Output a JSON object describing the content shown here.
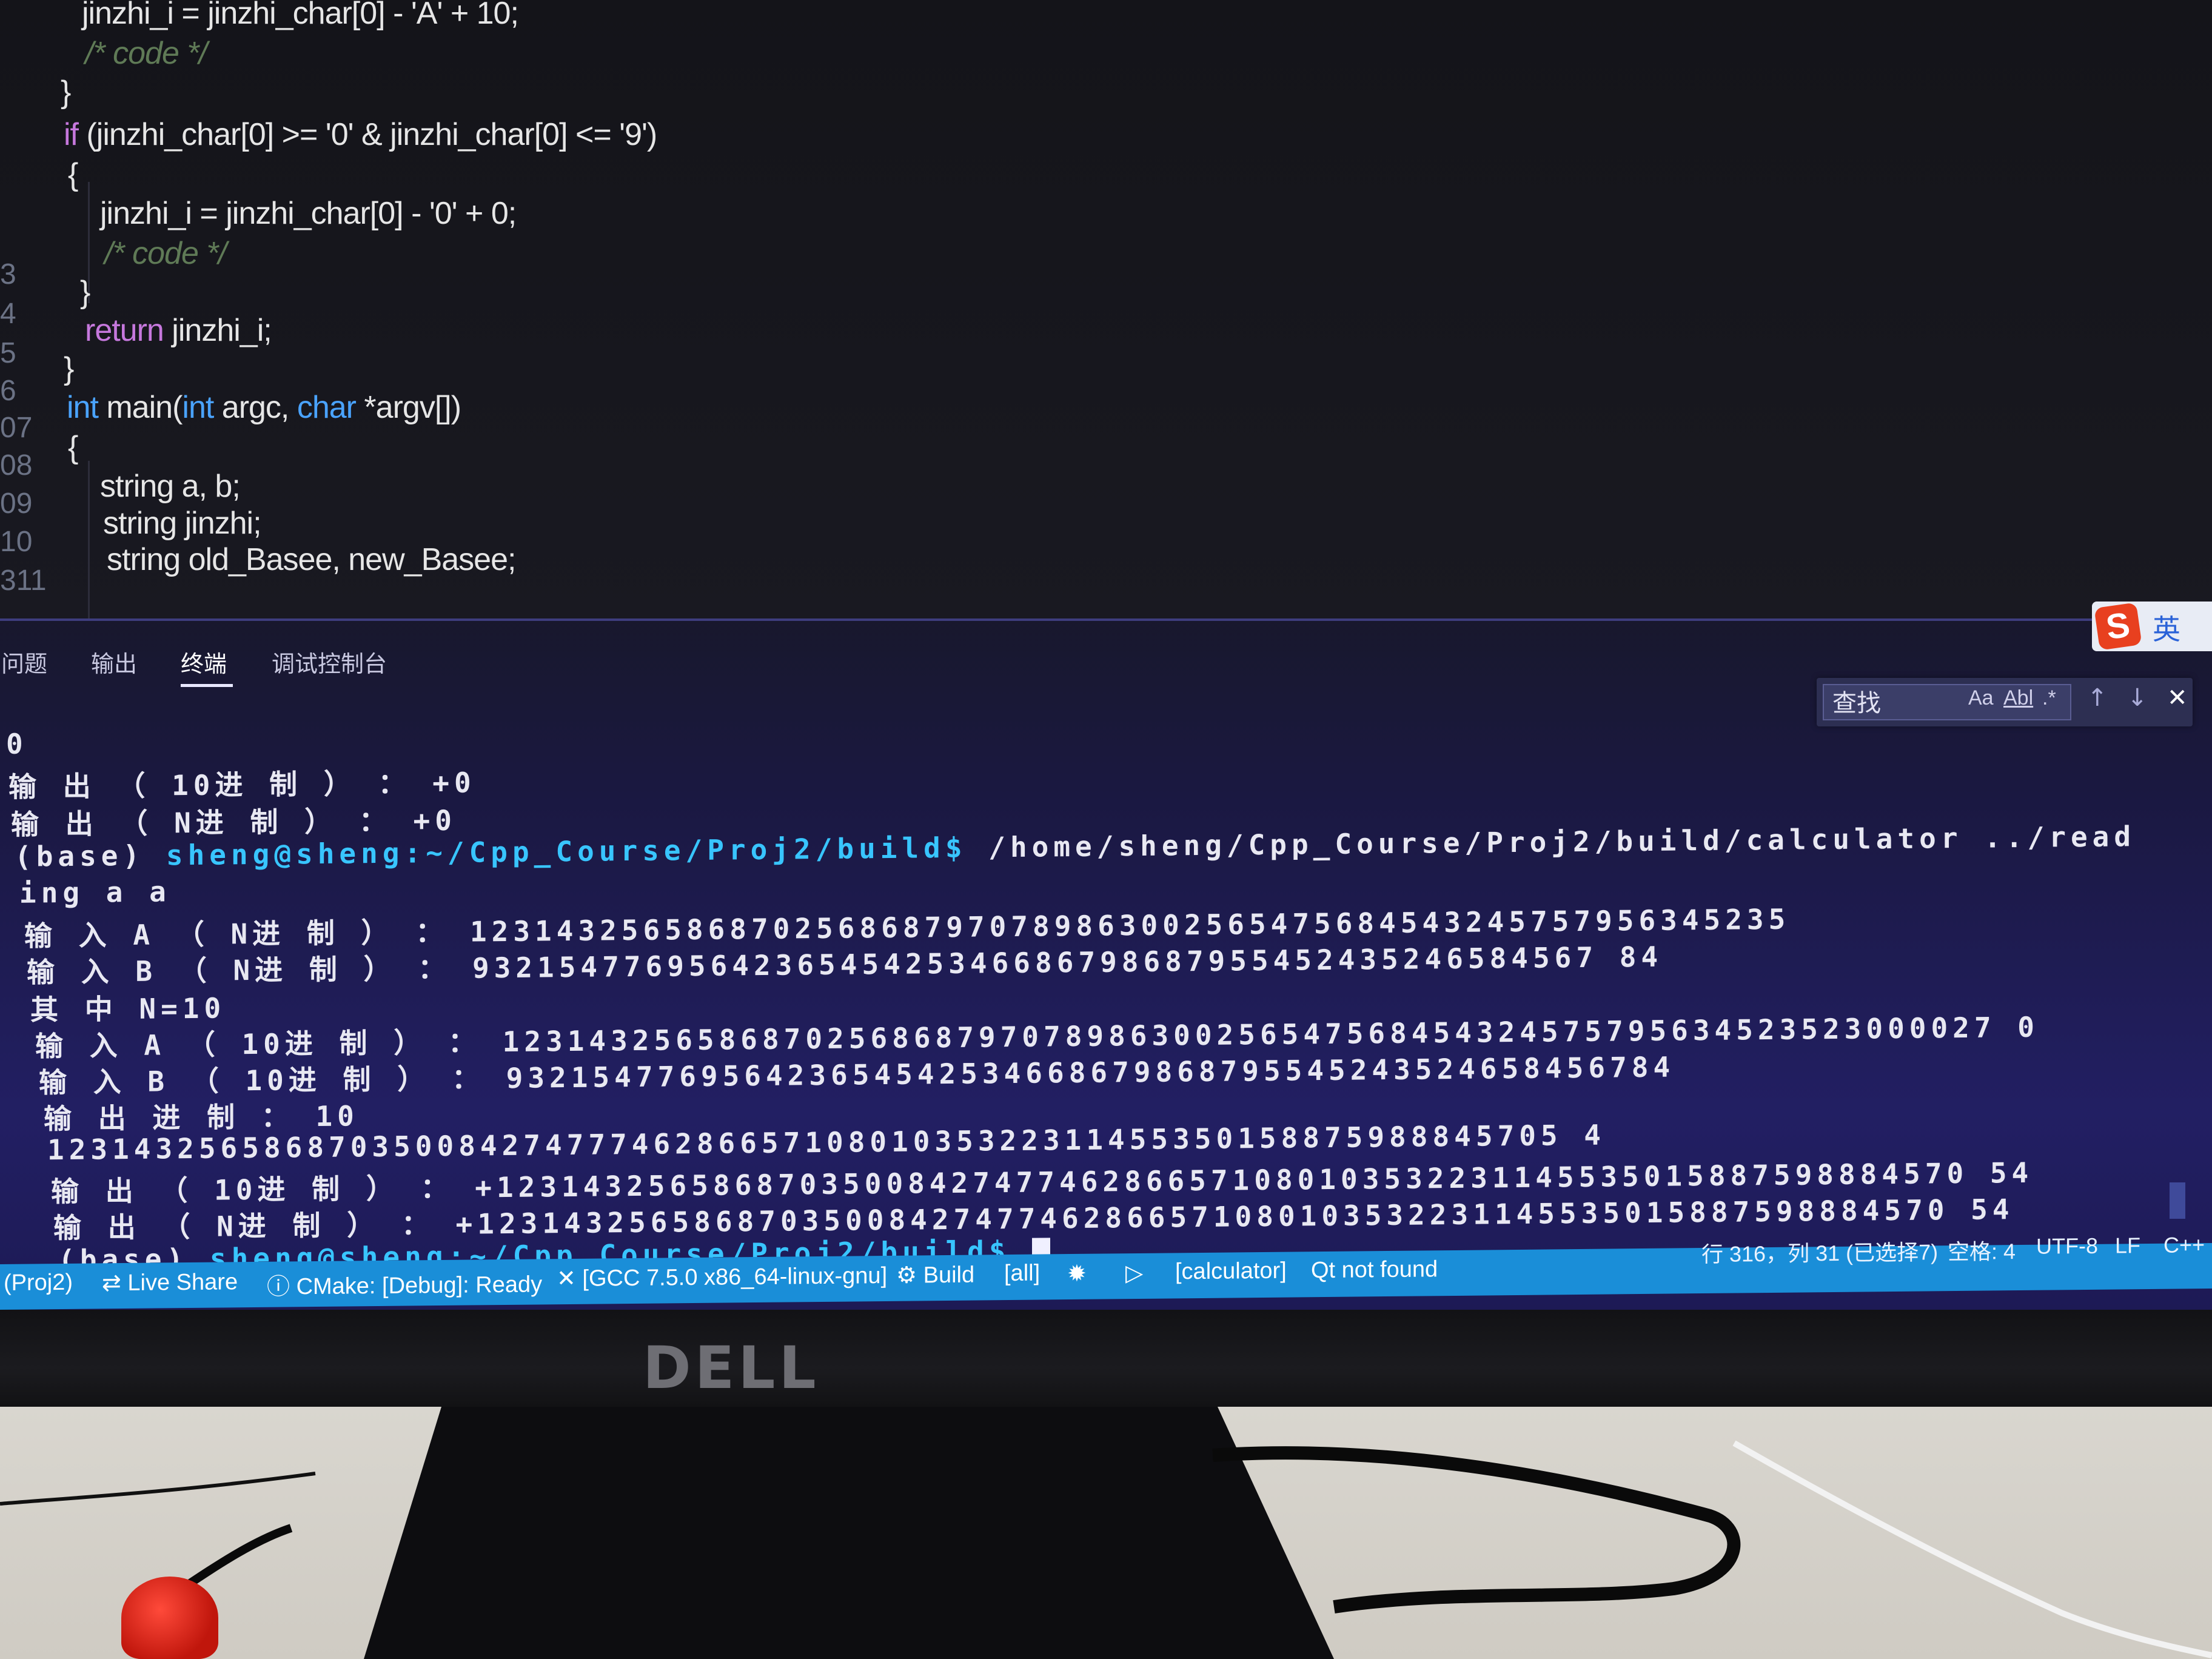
{
  "editor": {
    "line_numbers": [
      "",
      "",
      "",
      "",
      "",
      "",
      "3",
      "4",
      "5",
      "6",
      "07",
      "08",
      "09",
      "10",
      "311"
    ],
    "code": {
      "l1": "jinzhi_i = jinzhi_char[0] - 'A' + 10;",
      "l2": "/* code */",
      "l3": "}",
      "l4_kw": "if",
      "l4": " (jinzhi_char[0] >= '0' & jinzhi_char[0] <= '9')",
      "l5": "{",
      "l6": "jinzhi_i = jinzhi_char[0] - '0' + 0;",
      "l7": "/* code */",
      "l8": "}",
      "l9_kw": "return",
      "l9": " jinzhi_i;",
      "l10": "}",
      "l11_ty": "int",
      "l11_mid": " main(",
      "l11_ty2": "int",
      "l11_mid2": " argc, ",
      "l11_ty3": "char",
      "l11_end": " *argv[])",
      "l12": "{",
      "l13": "string a, b;",
      "l14": "string jinzhi;",
      "l15": "string old_Basee, new_Basee;"
    }
  },
  "panel": {
    "tabs": [
      "问题",
      "输出",
      "终端",
      "调试控制台"
    ],
    "active_tab": "终端"
  },
  "find": {
    "placeholder": "查找",
    "match_case": "Aa",
    "whole_word": "Abl",
    "regex": ".*",
    "up": "↑",
    "down": "↓",
    "close": "✕"
  },
  "ime": {
    "logo": "S",
    "mode": "英"
  },
  "terminal": {
    "lines": [
      "0",
      "输 出 （ 10进 制 ） ： +0",
      "输 出 （ N进 制 ） ： +0",
      "",
      "ing a a",
      "输 入 A （ N进 制 ） ： 1231432565868702568687970789863002565475684543245757956345235",
      "输 入 B （ N进 制 ） ： 9321547769564236545425346686798687955452435246584567 84",
      "其 中 N=10",
      "输 入 A （ 10进 制 ） ： 123143256586870256868797078986300256547568454324575795634523523000027 0",
      "输 入 B （ 10进 制 ） ： 932154776956423654542534668679868795545243524658456784",
      "输 出 进 制 ： 10",
      "1231432565868703500842747774628665710801035322311455350158875988845705 4",
      "输 出 （ 10进 制 ） ： +12314325658687035008427477462866571080103532231145535015887598884570 54",
      "输 出 （ N进 制 ） ： +12314325658687035008427477462866571080103532231145535015887598884570 54"
    ],
    "prompt1": {
      "env": "(base)",
      "user": "sheng@sheng",
      "path": ":~/Cpp_Course/Proj2/build$",
      "cmd": " /home/sheng/Cpp_Course/Proj2/build/calculator ../read"
    },
    "prompt2": {
      "env": "(base)",
      "user": "sheng@sheng",
      "path": ":~/Cpp_Course/Proj2/build$"
    }
  },
  "statusbar": {
    "project": "(Proj2)",
    "live_share": "Live Share",
    "cmake": "CMake: [Debug]: Ready",
    "kit": "[GCC 7.5.0 x86_64-linux-gnu]",
    "build": "Build",
    "target": "[all]",
    "launch_target": "[calculator]",
    "qt": "Qt not found",
    "cursor_pos": "行 316，列 31 (已选择7)",
    "spaces": "空格: 4",
    "encoding": "UTF-8",
    "eol": "LF",
    "language": "C++"
  },
  "monitor": {
    "brand": "DELL"
  }
}
